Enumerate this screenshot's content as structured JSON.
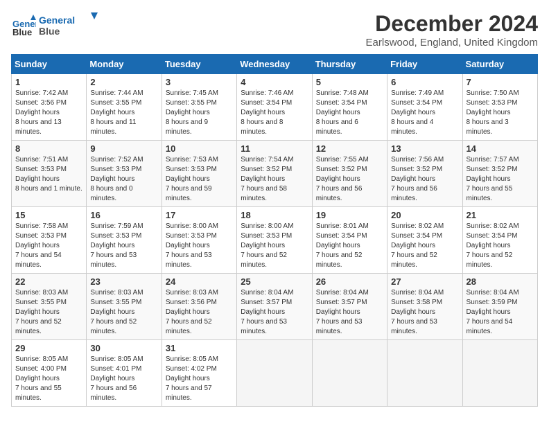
{
  "logo": {
    "line1": "General",
    "line2": "Blue"
  },
  "title": "December 2024",
  "location": "Earlswood, England, United Kingdom",
  "weekdays": [
    "Sunday",
    "Monday",
    "Tuesday",
    "Wednesday",
    "Thursday",
    "Friday",
    "Saturday"
  ],
  "weeks": [
    [
      {
        "day": "1",
        "sunrise": "7:42 AM",
        "sunset": "3:56 PM",
        "daylight": "8 hours and 13 minutes."
      },
      {
        "day": "2",
        "sunrise": "7:44 AM",
        "sunset": "3:55 PM",
        "daylight": "8 hours and 11 minutes."
      },
      {
        "day": "3",
        "sunrise": "7:45 AM",
        "sunset": "3:55 PM",
        "daylight": "8 hours and 9 minutes."
      },
      {
        "day": "4",
        "sunrise": "7:46 AM",
        "sunset": "3:54 PM",
        "daylight": "8 hours and 8 minutes."
      },
      {
        "day": "5",
        "sunrise": "7:48 AM",
        "sunset": "3:54 PM",
        "daylight": "8 hours and 6 minutes."
      },
      {
        "day": "6",
        "sunrise": "7:49 AM",
        "sunset": "3:54 PM",
        "daylight": "8 hours and 4 minutes."
      },
      {
        "day": "7",
        "sunrise": "7:50 AM",
        "sunset": "3:53 PM",
        "daylight": "8 hours and 3 minutes."
      }
    ],
    [
      {
        "day": "8",
        "sunrise": "7:51 AM",
        "sunset": "3:53 PM",
        "daylight": "8 hours and 1 minute."
      },
      {
        "day": "9",
        "sunrise": "7:52 AM",
        "sunset": "3:53 PM",
        "daylight": "8 hours and 0 minutes."
      },
      {
        "day": "10",
        "sunrise": "7:53 AM",
        "sunset": "3:53 PM",
        "daylight": "7 hours and 59 minutes."
      },
      {
        "day": "11",
        "sunrise": "7:54 AM",
        "sunset": "3:52 PM",
        "daylight": "7 hours and 58 minutes."
      },
      {
        "day": "12",
        "sunrise": "7:55 AM",
        "sunset": "3:52 PM",
        "daylight": "7 hours and 56 minutes."
      },
      {
        "day": "13",
        "sunrise": "7:56 AM",
        "sunset": "3:52 PM",
        "daylight": "7 hours and 56 minutes."
      },
      {
        "day": "14",
        "sunrise": "7:57 AM",
        "sunset": "3:52 PM",
        "daylight": "7 hours and 55 minutes."
      }
    ],
    [
      {
        "day": "15",
        "sunrise": "7:58 AM",
        "sunset": "3:53 PM",
        "daylight": "7 hours and 54 minutes."
      },
      {
        "day": "16",
        "sunrise": "7:59 AM",
        "sunset": "3:53 PM",
        "daylight": "7 hours and 53 minutes."
      },
      {
        "day": "17",
        "sunrise": "8:00 AM",
        "sunset": "3:53 PM",
        "daylight": "7 hours and 53 minutes."
      },
      {
        "day": "18",
        "sunrise": "8:00 AM",
        "sunset": "3:53 PM",
        "daylight": "7 hours and 52 minutes."
      },
      {
        "day": "19",
        "sunrise": "8:01 AM",
        "sunset": "3:54 PM",
        "daylight": "7 hours and 52 minutes."
      },
      {
        "day": "20",
        "sunrise": "8:02 AM",
        "sunset": "3:54 PM",
        "daylight": "7 hours and 52 minutes."
      },
      {
        "day": "21",
        "sunrise": "8:02 AM",
        "sunset": "3:54 PM",
        "daylight": "7 hours and 52 minutes."
      }
    ],
    [
      {
        "day": "22",
        "sunrise": "8:03 AM",
        "sunset": "3:55 PM",
        "daylight": "7 hours and 52 minutes."
      },
      {
        "day": "23",
        "sunrise": "8:03 AM",
        "sunset": "3:55 PM",
        "daylight": "7 hours and 52 minutes."
      },
      {
        "day": "24",
        "sunrise": "8:03 AM",
        "sunset": "3:56 PM",
        "daylight": "7 hours and 52 minutes."
      },
      {
        "day": "25",
        "sunrise": "8:04 AM",
        "sunset": "3:57 PM",
        "daylight": "7 hours and 53 minutes."
      },
      {
        "day": "26",
        "sunrise": "8:04 AM",
        "sunset": "3:57 PM",
        "daylight": "7 hours and 53 minutes."
      },
      {
        "day": "27",
        "sunrise": "8:04 AM",
        "sunset": "3:58 PM",
        "daylight": "7 hours and 53 minutes."
      },
      {
        "day": "28",
        "sunrise": "8:04 AM",
        "sunset": "3:59 PM",
        "daylight": "7 hours and 54 minutes."
      }
    ],
    [
      {
        "day": "29",
        "sunrise": "8:05 AM",
        "sunset": "4:00 PM",
        "daylight": "7 hours and 55 minutes."
      },
      {
        "day": "30",
        "sunrise": "8:05 AM",
        "sunset": "4:01 PM",
        "daylight": "7 hours and 56 minutes."
      },
      {
        "day": "31",
        "sunrise": "8:05 AM",
        "sunset": "4:02 PM",
        "daylight": "7 hours and 57 minutes."
      },
      null,
      null,
      null,
      null
    ]
  ]
}
